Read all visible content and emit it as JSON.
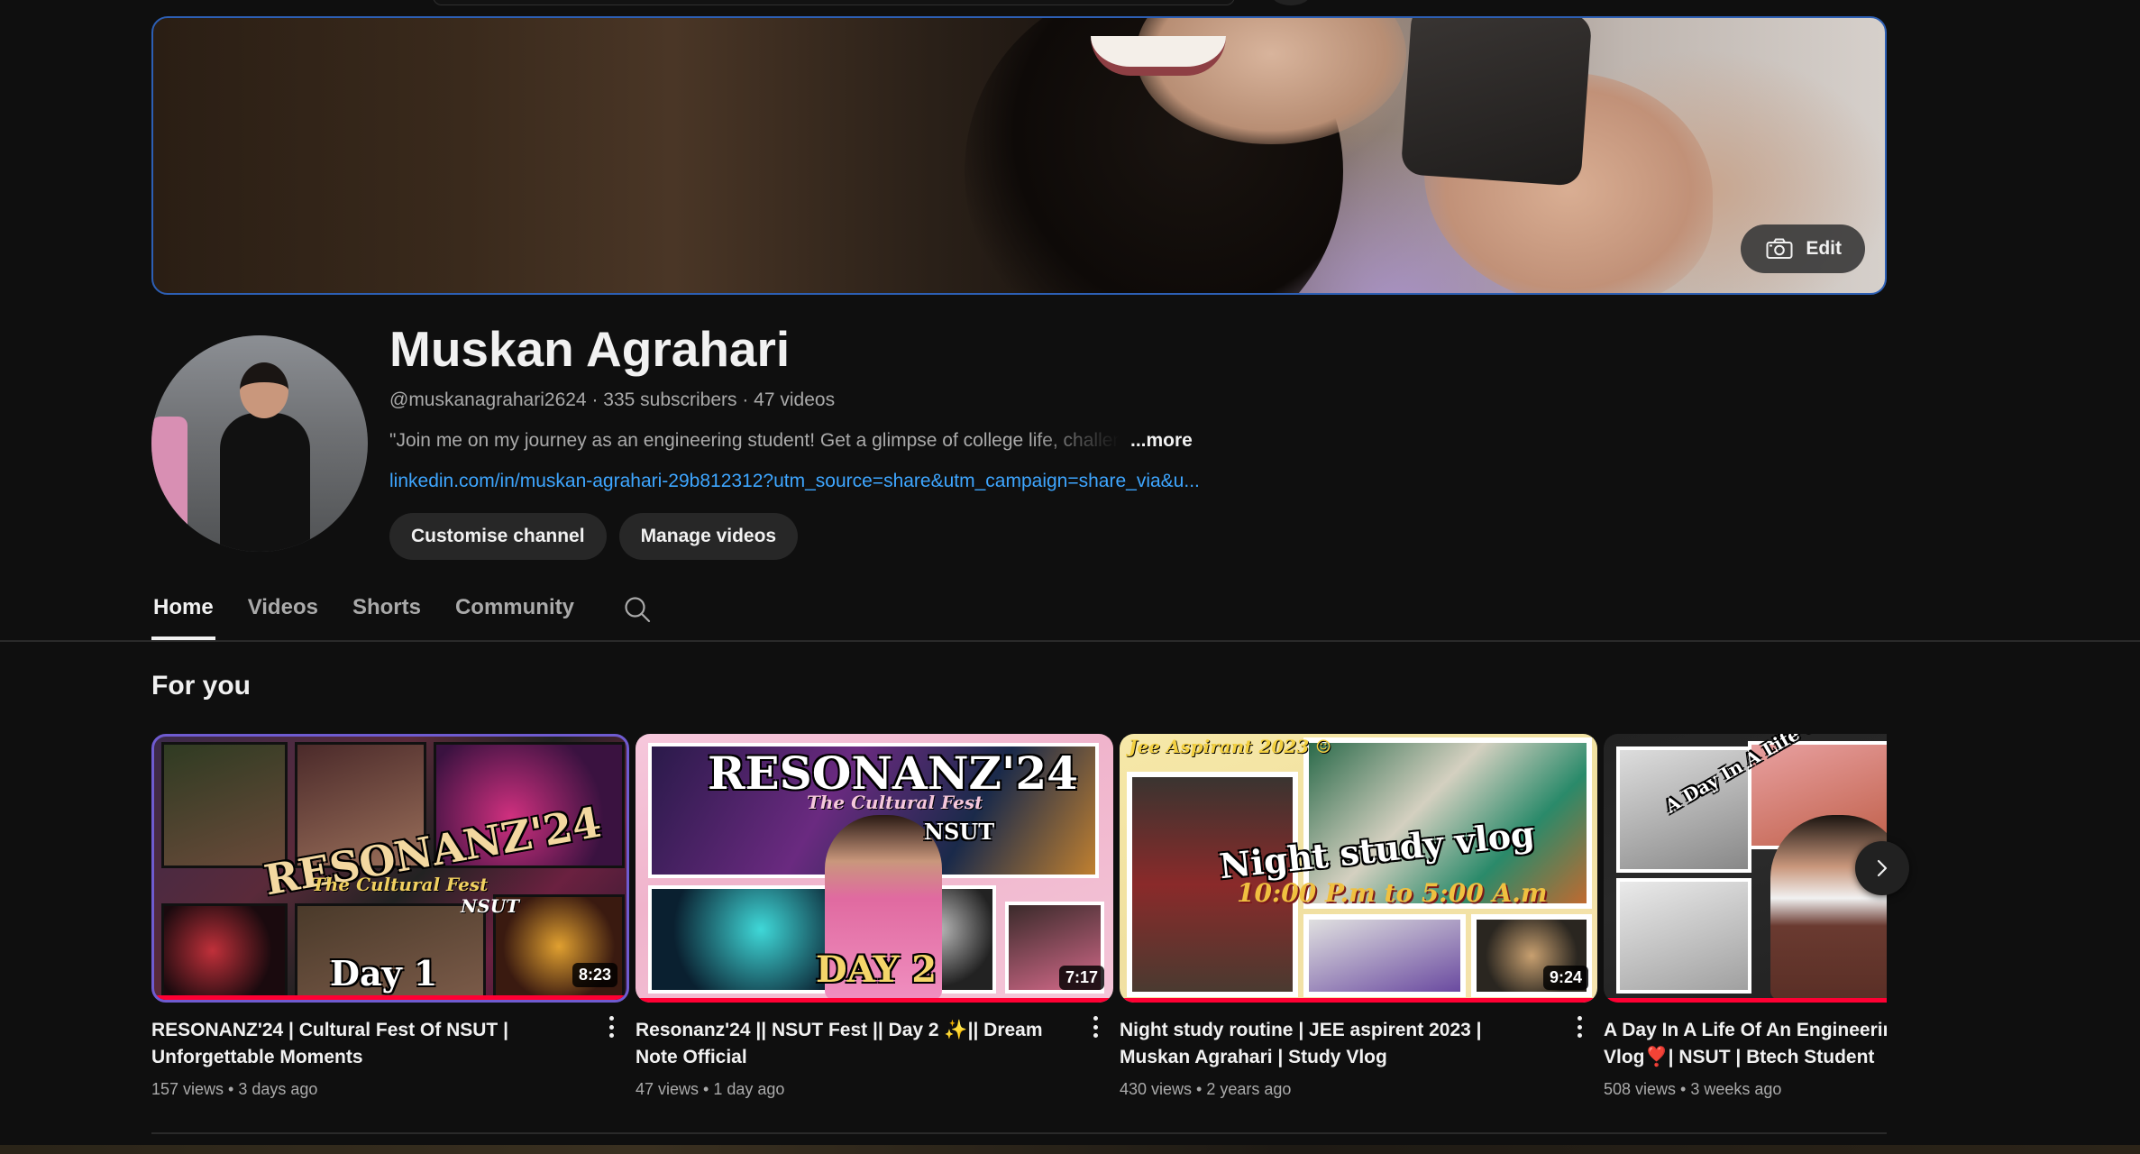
{
  "banner": {
    "edit_label": "Edit"
  },
  "channel": {
    "name": "Muskan Agrahari",
    "meta": "@muskanagrahari2624 · 335 subscribers · 47 videos",
    "description": "\"Join me on my journey as an engineering student! Get a glimpse of college life, challenges",
    "more_label": "...more",
    "link": "linkedin.com/in/muskan-agrahari-29b812312?utm_source=share&utm_campaign=share_via&u..."
  },
  "buttons": {
    "customise": "Customise channel",
    "manage": "Manage videos"
  },
  "tabs": [
    "Home",
    "Videos",
    "Shorts",
    "Community"
  ],
  "section_title": "For you",
  "videos": [
    {
      "title": "RESONANZ'24 | Cultural Fest Of NSUT | Unforgettable Moments",
      "meta": "157 views • 3 days ago",
      "duration": "8:23",
      "thumb_text": "RESONANZ'24",
      "thumb_sub": "The Cultural Fest",
      "thumb_tag": "NSUT",
      "thumb_day": "Day 1"
    },
    {
      "title": "Resonanz'24 || NSUT Fest || Day 2 ✨|| Dream Note Official",
      "meta": "47 views • 1 day ago",
      "duration": "7:17",
      "thumb_text": "RESONANZ'24",
      "thumb_sub": "The Cultural Fest",
      "thumb_tag": "NSUT",
      "thumb_day": "DAY 2"
    },
    {
      "title": "Night study routine | JEE aspirent 2023 | Muskan Agrahari | Study Vlog",
      "meta": "430 views • 2 years ago",
      "duration": "9:24",
      "thumb_text": "Night study vlog",
      "thumb_sub": "10:00 P.m to 5:00 A.m",
      "thumb_tag": "Jee Aspirant 2023 ☺",
      "thumb_day": ""
    },
    {
      "title": "A Day In A Life Of An Engineering College Vlog❣️| NSUT | Btech Student",
      "meta": "508 views • 3 weeks ago",
      "duration": "",
      "thumb_text": "A Day In A Life Of An Engi",
      "thumb_sub": "",
      "thumb_tag": "",
      "thumb_day": ""
    }
  ],
  "colors": {
    "background": "#0f0f0f",
    "link": "#3ea6ff",
    "progress": "#ff0033",
    "banner_border": "#2d5fb4"
  }
}
